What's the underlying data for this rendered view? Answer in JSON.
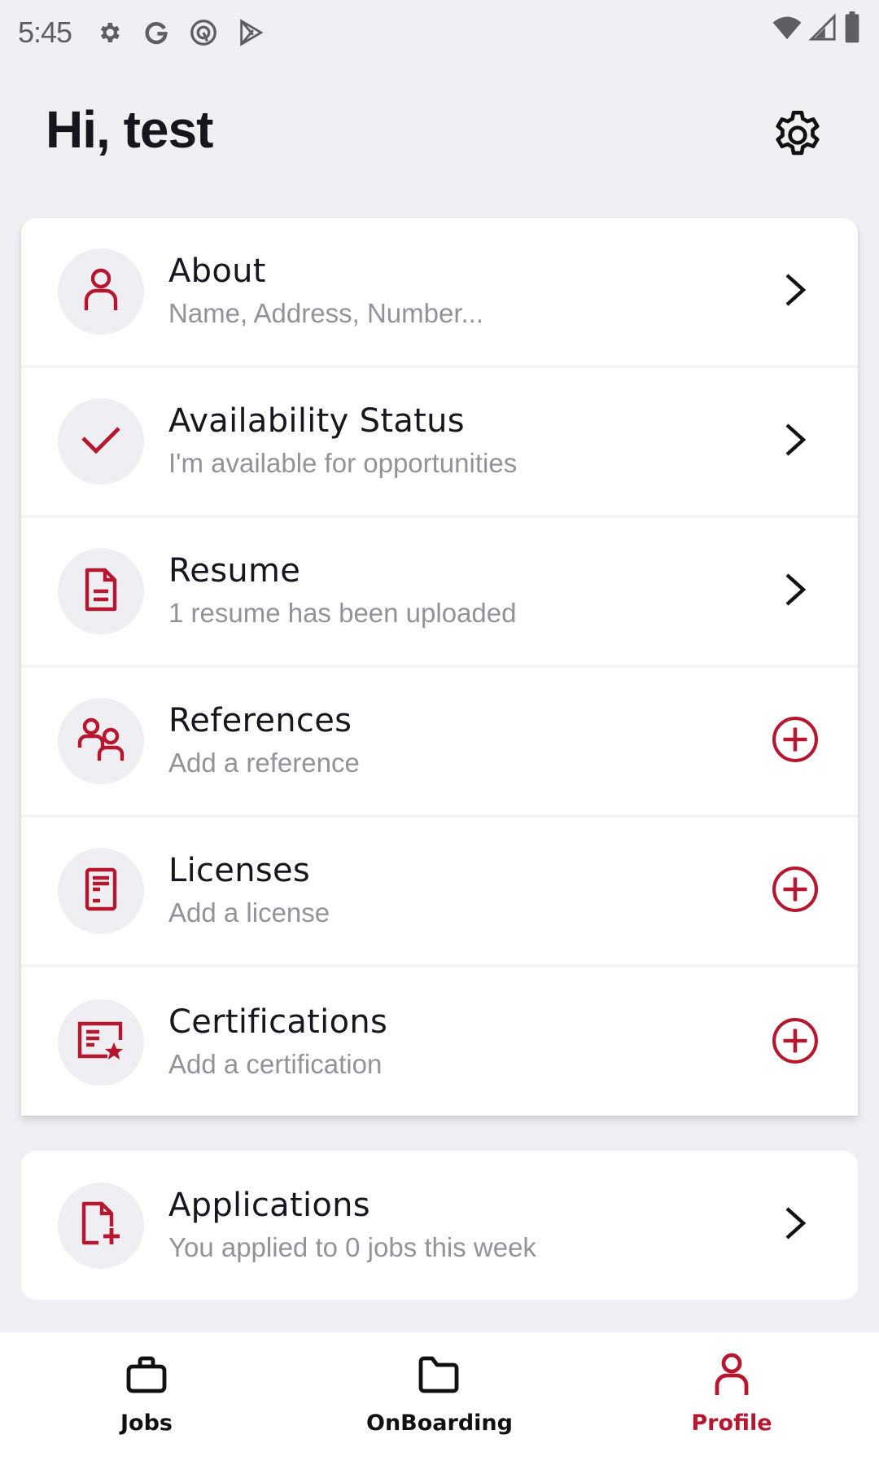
{
  "status_bar": {
    "time": "5:45",
    "left_icons": [
      "settings-gear-icon",
      "google-g-icon",
      "at-sign-icon",
      "play-store-icon"
    ],
    "right_icons": [
      "wifi-icon",
      "cell-signal-icon",
      "battery-icon"
    ]
  },
  "header": {
    "greeting": "Hi, test",
    "settings_icon": "gear-icon"
  },
  "colors": {
    "accent": "#b5172f",
    "background": "#f0eff4",
    "card": "#ffffff",
    "icon_circle": "#efeef3",
    "title_text": "#16161f",
    "subtitle_text": "#93929a"
  },
  "profile_sections": [
    {
      "title": "About",
      "subtitle": "Name, Address, Number...",
      "icon": "person-icon",
      "action": "chevron-right"
    },
    {
      "title": "Availability Status",
      "subtitle": "I'm available for opportunities",
      "icon": "checkmark-icon",
      "action": "chevron-right"
    },
    {
      "title": "Resume",
      "subtitle": "1 resume has been uploaded",
      "icon": "document-icon",
      "action": "chevron-right"
    },
    {
      "title": "References",
      "subtitle": "Add a reference",
      "icon": "people-icon",
      "action": "add"
    },
    {
      "title": "Licenses",
      "subtitle": "Add a license",
      "icon": "license-icon",
      "action": "add"
    },
    {
      "title": "Certifications",
      "subtitle": "Add a certification",
      "icon": "certificate-icon",
      "action": "add"
    }
  ],
  "applications": {
    "title": "Applications",
    "subtitle": "You applied to 0 jobs this week",
    "icon": "file-add-icon",
    "action": "chevron-right"
  },
  "bottom_nav": {
    "items": [
      {
        "label": "Jobs",
        "icon": "briefcase-icon",
        "active": false
      },
      {
        "label": "OnBoarding",
        "icon": "folder-icon",
        "active": false
      },
      {
        "label": "Profile",
        "icon": "person-icon",
        "active": true
      }
    ]
  }
}
